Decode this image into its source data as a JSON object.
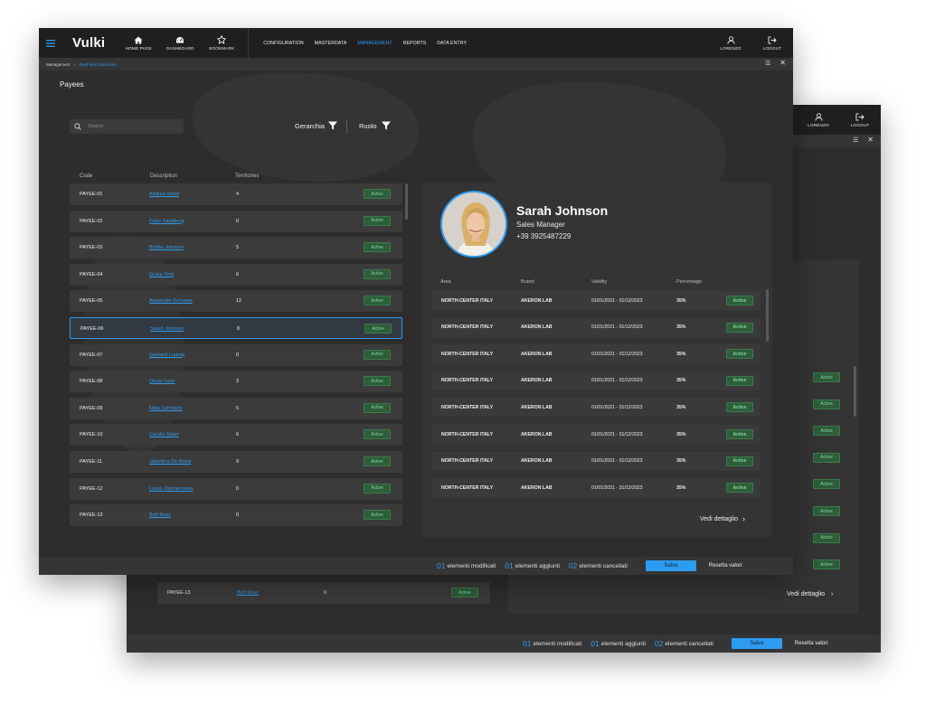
{
  "app": {
    "brand": "Vulki"
  },
  "topnav": {
    "home_label": "HOME PAGE",
    "dashboard_label": "DASHBOARD",
    "bookmark_label": "BOOKMARK",
    "menu": [
      "CONFIGURATION",
      "MASTERDATA",
      "MANAGEMENT",
      "REPORTS",
      "DATA ENTRY"
    ],
    "active_menu": "MANAGEMENT",
    "user_label": "LORENZO",
    "logout_label": "LOGOUT"
  },
  "breadcrumb": {
    "root": "Management",
    "separator": "»",
    "current": "Real-time Document"
  },
  "page": {
    "title": "Payees"
  },
  "search": {
    "placeholder": "Search"
  },
  "filters": {
    "hierarchy_label": "Gerarchia",
    "role_label": "Ruolo"
  },
  "table": {
    "columns": [
      "Code",
      "Description",
      "Territories"
    ],
    "rows": [
      {
        "code": "PAYEE-01",
        "desc": "Andrea Rossi",
        "terr": "4",
        "status": "Active"
      },
      {
        "code": "PAYEE-02",
        "desc": "Peter Sandberg",
        "terr": "0",
        "status": "Active"
      },
      {
        "code": "PAYEE-03",
        "desc": "Bobby Johnson",
        "terr": "5",
        "status": "Active"
      },
      {
        "code": "PAYEE-04",
        "desc": "Grace York",
        "terr": "6",
        "status": "Active"
      },
      {
        "code": "PAYEE-05",
        "desc": "Alexander Schuster",
        "terr": "12",
        "status": "Active"
      },
      {
        "code": "PAYEE-06",
        "desc": "Sarah Johnson",
        "terr": "8",
        "status": "Active"
      },
      {
        "code": "PAYEE-07",
        "desc": "Gerhard Ludwig",
        "terr": "0",
        "status": "Active"
      },
      {
        "code": "PAYEE-08",
        "desc": "Oscar Lane",
        "terr": "3",
        "status": "Active"
      },
      {
        "code": "PAYEE-09",
        "desc": "Niels Lehmann",
        "terr": "5",
        "status": "Active"
      },
      {
        "code": "PAYEE-10",
        "desc": "Carolin Maier",
        "terr": "6",
        "status": "Active"
      },
      {
        "code": "PAYEE-11",
        "desc": "Valentina De Rossi",
        "terr": "9",
        "status": "Active"
      },
      {
        "code": "PAYEE-12",
        "desc": "Lukas Zimmermann",
        "terr": "0",
        "status": "Active"
      },
      {
        "code": "PAYEE-13",
        "desc": "Bob Ross",
        "terr": "0",
        "status": "Active"
      }
    ],
    "selected_index": 5
  },
  "profile": {
    "name": "Sarah Johnson",
    "role": "Sales Manager",
    "phone": "+39 3925487229"
  },
  "assignments": {
    "columns": [
      "Area",
      "Brand",
      "Validity",
      "Percentage"
    ],
    "rows": [
      {
        "area": "NORTH-CENTER ITALY",
        "brand": "AKERON LAB",
        "validity": "01/01/2021 - 31/12/2023",
        "pct": "35%",
        "status": "Active"
      },
      {
        "area": "NORTH-CENTER ITALY",
        "brand": "AKERON LAB",
        "validity": "01/01/2021 - 31/12/2023",
        "pct": "35%",
        "status": "Active"
      },
      {
        "area": "NORTH-CENTER ITALY",
        "brand": "AKERON LAB",
        "validity": "01/01/2021 - 31/12/2023",
        "pct": "35%",
        "status": "Active"
      },
      {
        "area": "NORTH-CENTER ITALY",
        "brand": "AKERON LAB",
        "validity": "01/01/2021 - 31/12/2023",
        "pct": "35%",
        "status": "Active"
      },
      {
        "area": "NORTH-CENTER ITALY",
        "brand": "AKERON LAB",
        "validity": "01/01/2021 - 31/12/2023",
        "pct": "35%",
        "status": "Active"
      },
      {
        "area": "NORTH-CENTER ITALY",
        "brand": "AKERON LAB",
        "validity": "01/01/2021 - 31/12/2023",
        "pct": "35%",
        "status": "Active"
      },
      {
        "area": "NORTH-CENTER ITALY",
        "brand": "AKERON LAB",
        "validity": "01/01/2021 - 31/12/2023",
        "pct": "35%",
        "status": "Active"
      },
      {
        "area": "NORTH-CENTER ITALY",
        "brand": "AKERON LAB",
        "validity": "01/01/2021 - 31/12/2023",
        "pct": "35%",
        "status": "Active"
      }
    ],
    "details_link": "Vedi dettaglio"
  },
  "footer": {
    "modified_count": "01",
    "modified_label": "elementi modificati",
    "added_count": "01",
    "added_label": "elementi aggiunti",
    "deleted_count": "02",
    "deleted_label": "elementi cancellati",
    "save_label": "Salva",
    "reset_label": "Resetta valori"
  },
  "back_window": {
    "badges": [
      "Active",
      "Active",
      "Active",
      "Active",
      "Active",
      "Active",
      "Active",
      "Active"
    ],
    "last_row": {
      "code": "PAYEE-13",
      "desc": "Bob Ross",
      "terr": "0",
      "status": "Active"
    },
    "details_link": "Vedi dettaglio"
  },
  "colors": {
    "accent": "#2d9bf0",
    "active_badge": "#2e5d3a",
    "bg": "#2d2d2d",
    "topbar": "#1f1f1f"
  }
}
